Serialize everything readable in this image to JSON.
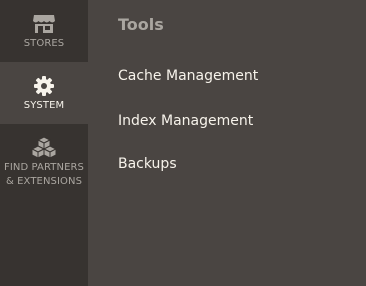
{
  "sidebar": {
    "items": [
      {
        "label": "STORES",
        "icon": "store-icon"
      },
      {
        "label": "SYSTEM",
        "icon": "gear-icon",
        "active": true
      },
      {
        "label": "FIND PARTNERS\n& EXTENSIONS",
        "icon": "cubes-icon"
      }
    ]
  },
  "panel": {
    "title": "Tools",
    "links": [
      {
        "label": "Cache Management"
      },
      {
        "label": "Index Management"
      },
      {
        "label": "Backups"
      }
    ]
  },
  "colors": {
    "sidebar_bg": "#373330",
    "active_bg": "#4a4542",
    "panel_bg": "#4a4542",
    "muted_text": "#aaa6a0",
    "bright_text": "#f7f3eb"
  }
}
